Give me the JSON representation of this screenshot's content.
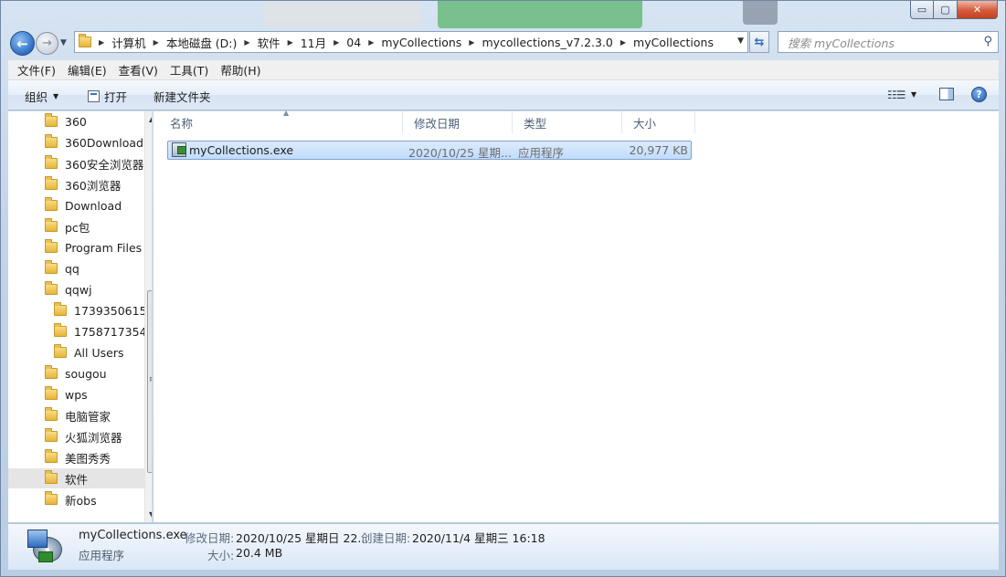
{
  "window": {
    "caption_buttons": {
      "minimize": "▭",
      "maximize": "▢",
      "close": "✕"
    }
  },
  "nav": {
    "back_icon": "back-arrow-icon",
    "forward_icon": "forward-arrow-icon"
  },
  "address": {
    "crumbs": [
      "计算机",
      "本地磁盘 (D:)",
      "软件",
      "11月",
      "04",
      "myCollections",
      "mycollections_v7.2.3.0",
      "myCollections"
    ]
  },
  "search": {
    "placeholder": "搜索 myCollections"
  },
  "menu": {
    "items": [
      "文件(F)",
      "编辑(E)",
      "查看(V)",
      "工具(T)",
      "帮助(H)"
    ]
  },
  "toolbar": {
    "organize": "组织",
    "open": "打开",
    "new_folder": "新建文件夹"
  },
  "tree": {
    "items": [
      {
        "label": "360",
        "level": 0
      },
      {
        "label": "360Download",
        "level": 0
      },
      {
        "label": "360安全浏览器",
        "level": 0
      },
      {
        "label": "360浏览器",
        "level": 0
      },
      {
        "label": "Download",
        "level": 0
      },
      {
        "label": "pc包",
        "level": 0
      },
      {
        "label": "Program Files",
        "level": 0
      },
      {
        "label": "qq",
        "level": 0
      },
      {
        "label": "qqwj",
        "level": 0
      },
      {
        "label": "1739350615",
        "level": 1
      },
      {
        "label": "1758717354",
        "level": 1
      },
      {
        "label": "All Users",
        "level": 1
      },
      {
        "label": "sougou",
        "level": 0
      },
      {
        "label": "wps",
        "level": 0
      },
      {
        "label": "电脑管家",
        "level": 0
      },
      {
        "label": "火狐浏览器",
        "level": 0
      },
      {
        "label": "美图秀秀",
        "level": 0
      },
      {
        "label": "软件",
        "level": 0,
        "selected": true
      },
      {
        "label": "新obs",
        "level": 0
      }
    ]
  },
  "files": {
    "columns": [
      "名称",
      "修改日期",
      "类型",
      "大小"
    ],
    "rows": [
      {
        "name": "myCollections.exe",
        "modified": "2020/10/25 星期...",
        "type": "应用程序",
        "size": "20,977 KB"
      }
    ]
  },
  "details": {
    "filename": "myCollections.exe",
    "type": "应用程序",
    "modified_label": "修改日期:",
    "modified_value": "2020/10/25 星期日 22...",
    "created_label": "创建日期:",
    "created_value": "2020/11/4 星期三 16:18",
    "size_label": "大小:",
    "size_value": "20.4 MB"
  }
}
